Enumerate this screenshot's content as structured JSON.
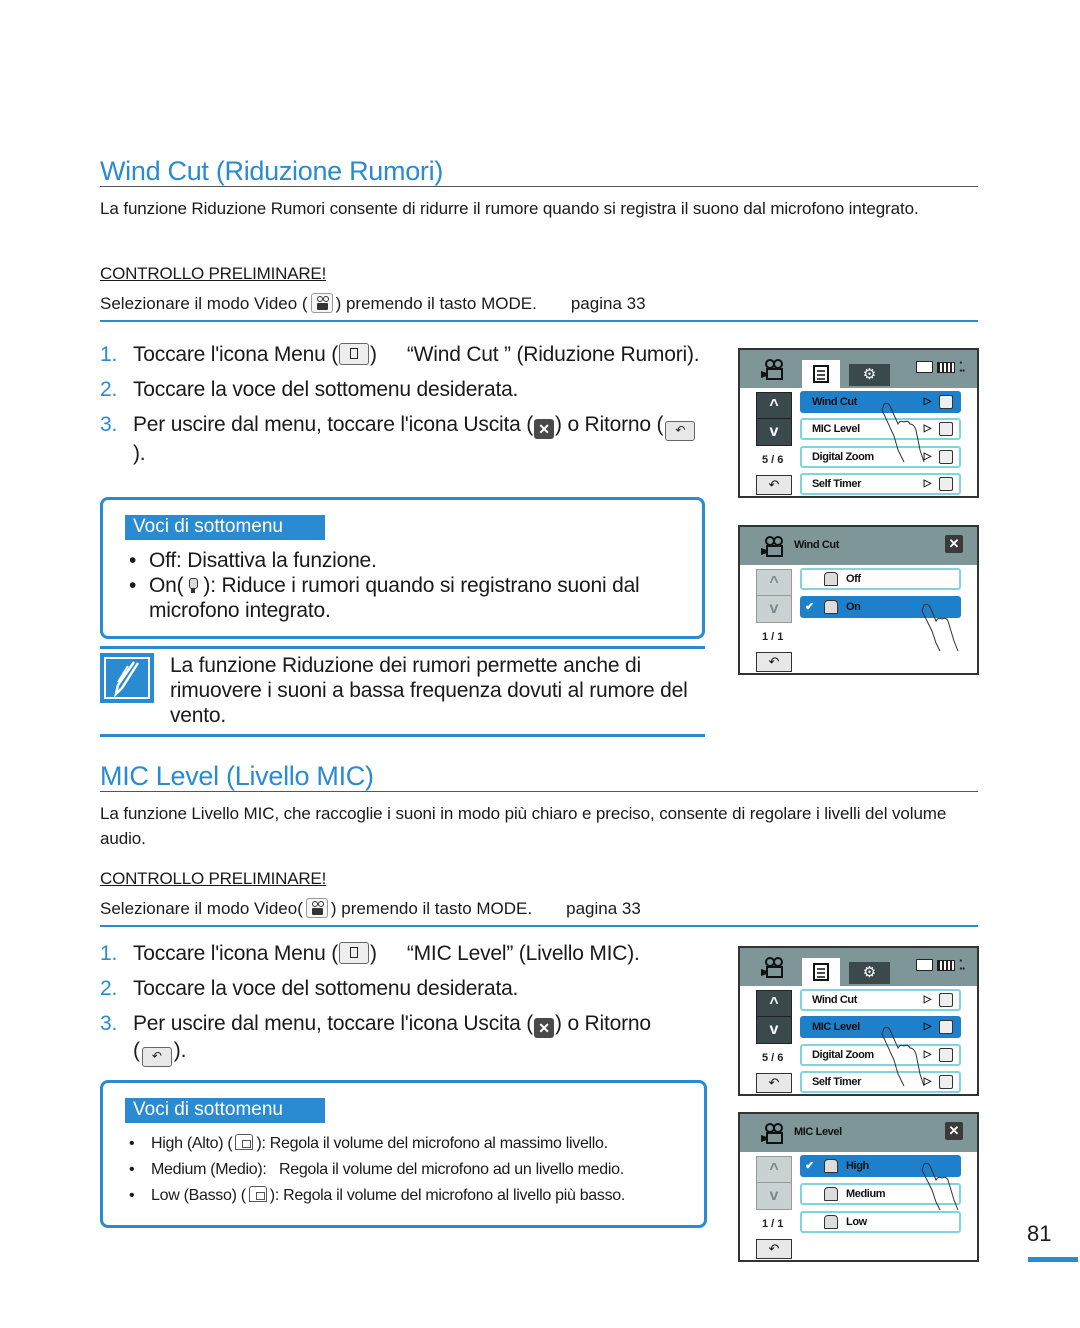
{
  "page_number": "81",
  "accent_color": "#2a8ad2",
  "wind_cut": {
    "title": "Wind Cut (Riduzione Rumori)",
    "intro": "La funzione Riduzione Rumori consente di ridurre il rumore quando si registra il suono dal microfono integrato.",
    "prelim_heading": "CONTROLLO PRELIMINARE!",
    "prelim_text_a": "Selezionare il modo Video (",
    "prelim_text_b": ") premendo il tasto MODE.",
    "prelim_page": "pagina 33",
    "steps": [
      {
        "num": "1.",
        "a": "Toccare l'icona Menu (",
        "b": ")",
        "c": "“Wind Cut ” (Riduzione Rumori)."
      },
      {
        "num": "2.",
        "a": "Toccare la voce del sottomenu desiderata."
      },
      {
        "num": "3.",
        "a": "Per uscire dal menu, toccare l'icona Uscita (",
        "b": ") o Ritorno (",
        "c": ")."
      }
    ],
    "submenu_title": "Voci di sottomenu",
    "submenu_items": [
      {
        "a": "Off: Disattiva la funzione."
      },
      {
        "a": "On(",
        "b": "): Riduce i rumori quando si registrano suoni dal microfono integrato."
      }
    ],
    "note": "La funzione Riduzione dei rumori permette anche di rimuovere i suoni a bassa frequenza dovuti al rumore del vento.",
    "screen1": {
      "page": "5 / 6",
      "items": [
        "Wind Cut",
        "MIC Level",
        "Digital Zoom",
        "Self Timer"
      ],
      "selected": "Wind Cut"
    },
    "screen2": {
      "title": "Wind Cut",
      "page": "1 / 1",
      "options": [
        "Off",
        "On"
      ],
      "selected": "On"
    }
  },
  "mic_level": {
    "title": "MIC Level (Livello MIC)",
    "intro": "La funzione Livello MIC, che raccoglie i suoni in modo più chiaro e preciso, consente di regolare i livelli del volume audio.",
    "prelim_heading": "CONTROLLO PRELIMINARE!",
    "prelim_text_a": "Selezionare il modo Video(",
    "prelim_text_b": ") premendo il tasto MODE.",
    "prelim_page": "pagina 33",
    "steps": [
      {
        "num": "1.",
        "a": "Toccare l'icona Menu (",
        "b": ")",
        "c": "“MIC Level” (Livello MIC)."
      },
      {
        "num": "2.",
        "a": "Toccare la voce del sottomenu desiderata."
      },
      {
        "num": "3.",
        "a": "Per uscire dal menu, toccare l'icona Uscita (",
        "b": ") o Ritorno (",
        "c": ")."
      }
    ],
    "submenu_title": "Voci di sottomenu",
    "submenu_items": [
      {
        "a": "High (Alto) (",
        "b": "): Regola il volume del microfono al massimo livello."
      },
      {
        "a": "Medium (Medio):   Regola il volume del microfono ad un livello medio."
      },
      {
        "a": "Low (Basso) (",
        "b": "): Regola il volume del microfono al livello più basso."
      }
    ],
    "screen1": {
      "page": "5 / 6",
      "items": [
        "Wind Cut",
        "MIC Level",
        "Digital Zoom",
        "Self Timer"
      ],
      "selected": "MIC Level"
    },
    "screen2": {
      "title": "MIC Level",
      "page": "1 / 1",
      "options": [
        "High",
        "Medium",
        "Low"
      ],
      "selected": "High"
    }
  },
  "icons": {
    "up": "^",
    "down": "v",
    "back": "↶",
    "close": "✕",
    "gear": "⚙",
    "check": "✔",
    "arrow": "▷"
  }
}
